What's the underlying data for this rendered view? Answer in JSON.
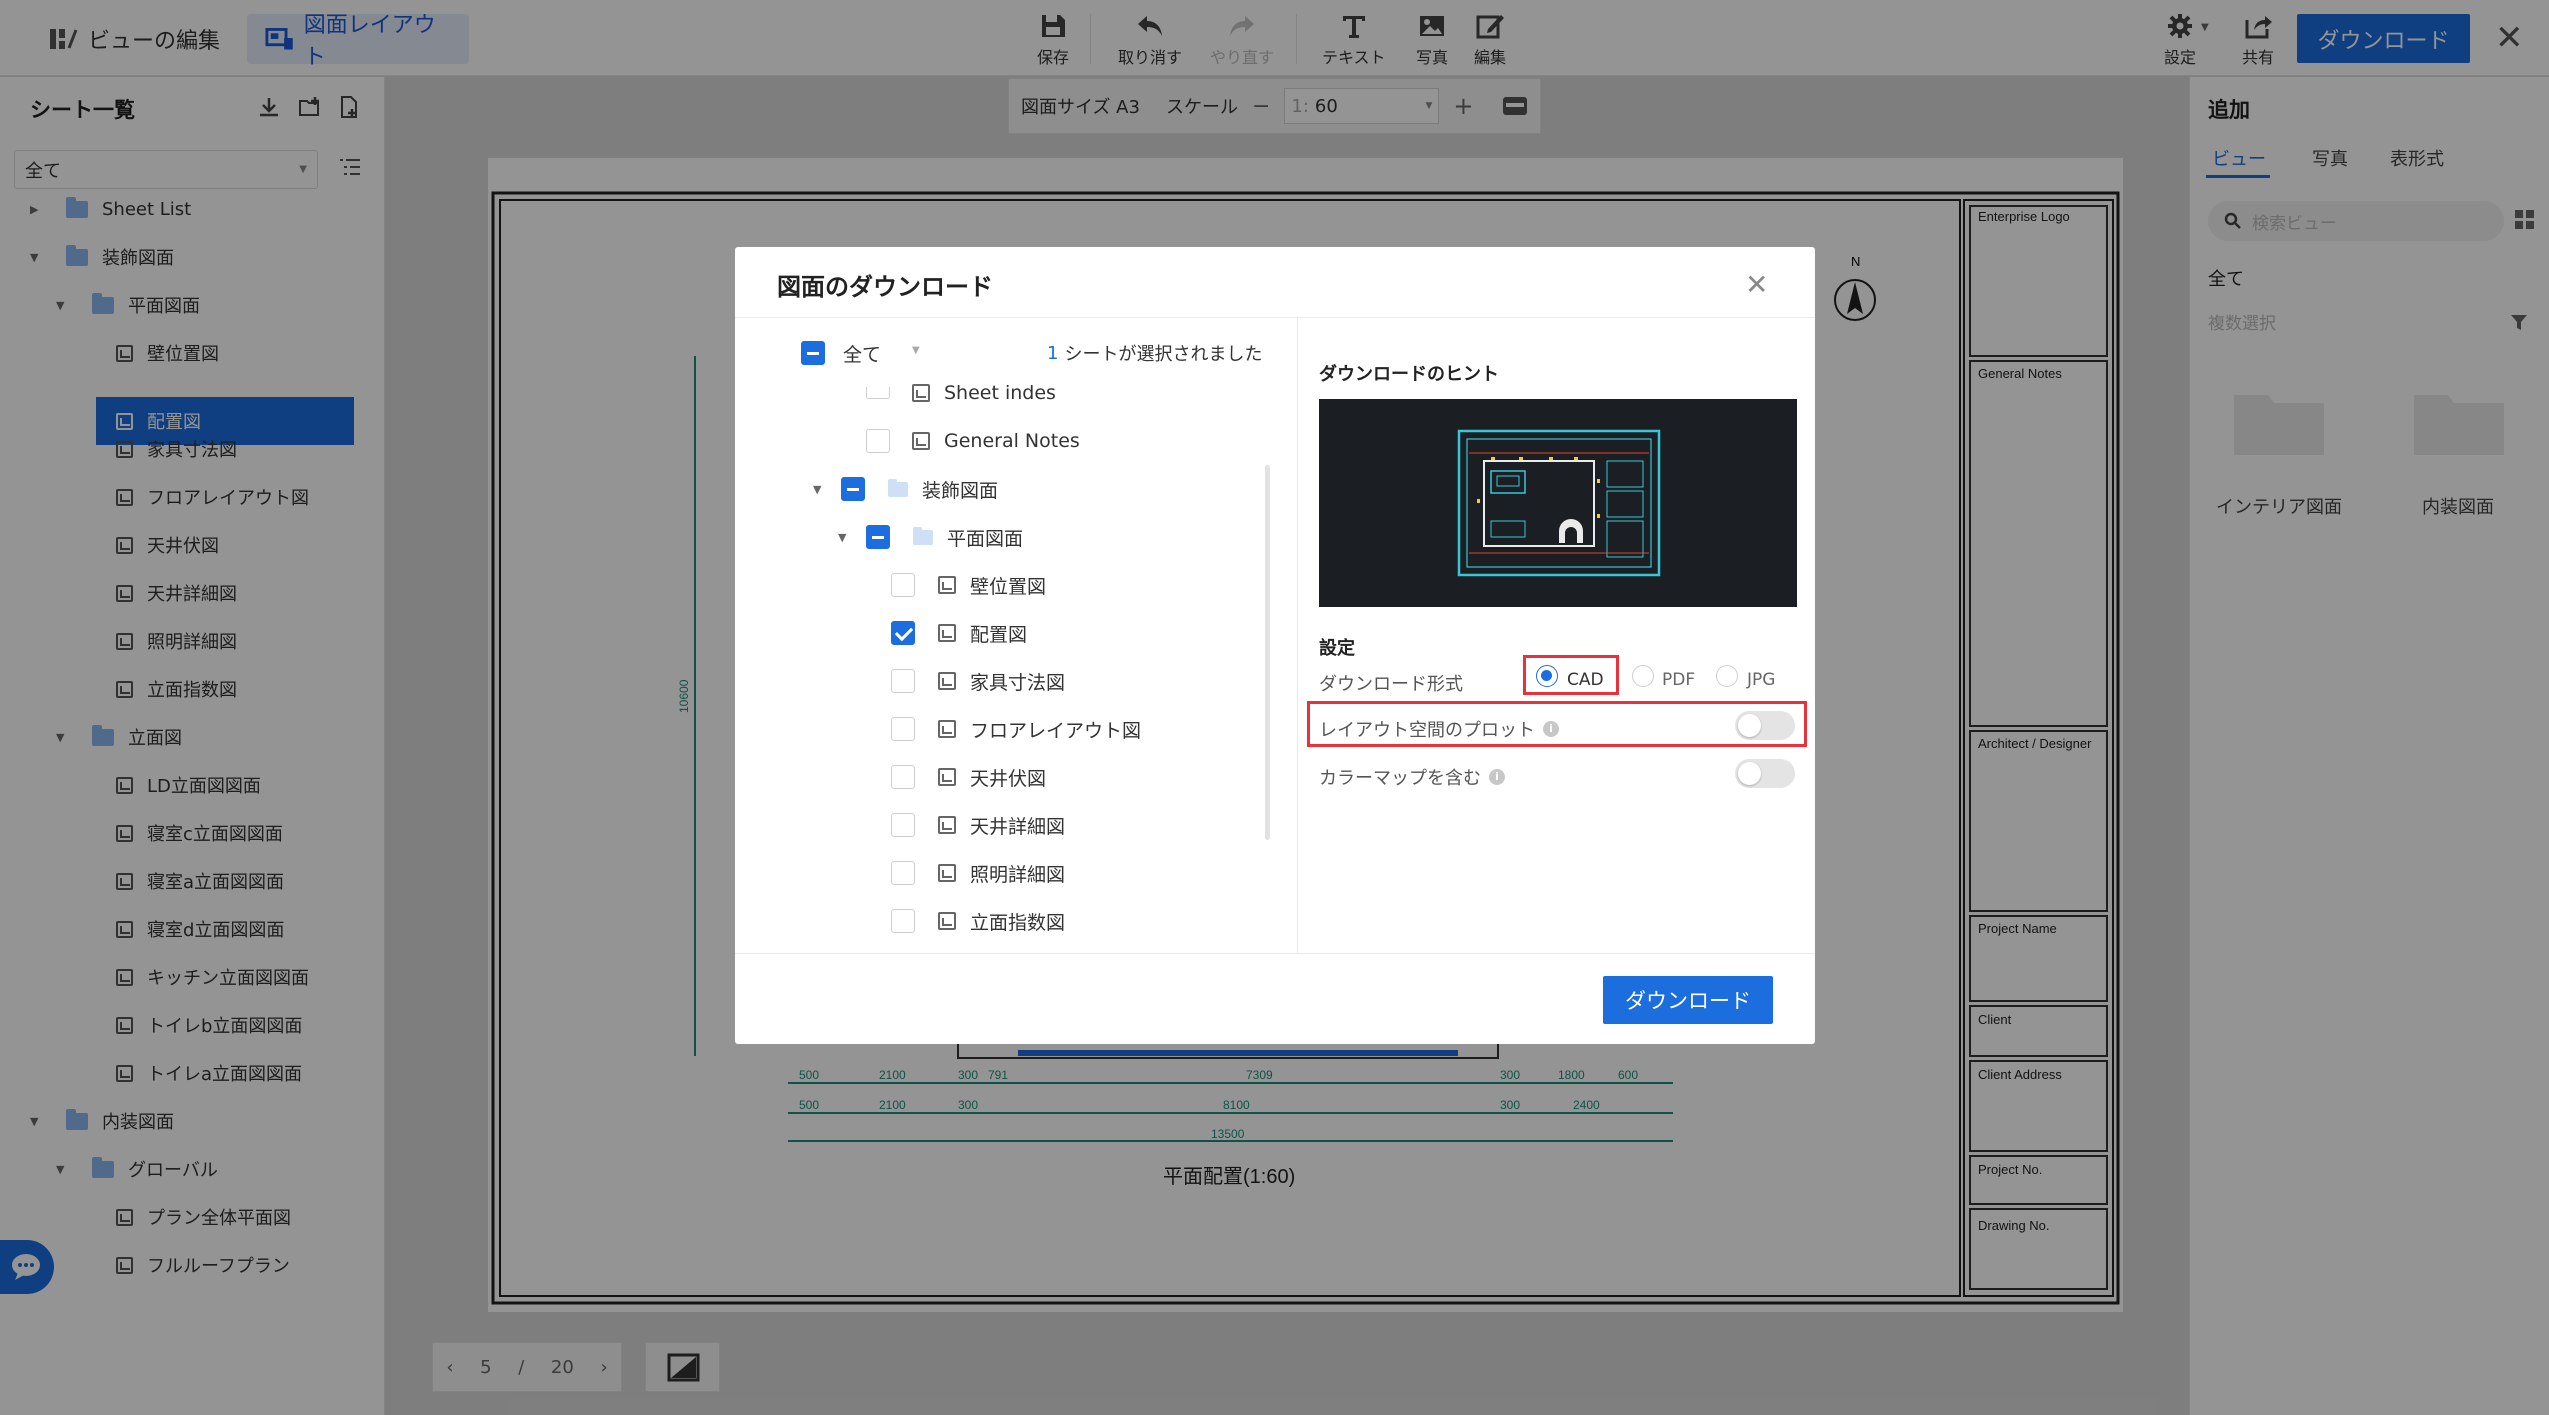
{
  "topbar": {
    "mode_view_edit": "ビューの編集",
    "mode_layout": "図面レイアウト",
    "tools": {
      "save": "保存",
      "undo": "取り消す",
      "redo": "やり直す",
      "text": "テキスト",
      "photo": "写真",
      "edit": "編集"
    },
    "settings": "設定",
    "share": "共有",
    "download": "ダウンロード"
  },
  "sidebar": {
    "title": "シート一覧",
    "filter": "全て",
    "items": [
      {
        "label": "Sheet List"
      },
      {
        "label": "装飾図面"
      },
      {
        "label": "平面図面"
      },
      {
        "label": "壁位置図"
      },
      {
        "label": "配置図"
      },
      {
        "label": "家具寸法図"
      },
      {
        "label": "フロアレイアウト図"
      },
      {
        "label": "天井伏図"
      },
      {
        "label": "天井詳細図"
      },
      {
        "label": "照明詳細図"
      },
      {
        "label": "立面指数図"
      },
      {
        "label": "立面図"
      },
      {
        "label": "LD立面図図面"
      },
      {
        "label": "寝室c立面図図面"
      },
      {
        "label": "寝室a立面図図面"
      },
      {
        "label": "寝室d立面図図面"
      },
      {
        "label": "キッチン立面図図面"
      },
      {
        "label": "トイレb立面図図面"
      },
      {
        "label": "トイレa立面図図面"
      },
      {
        "label": "内装図面"
      },
      {
        "label": "グローバル"
      },
      {
        "label": "プラン全体平面図"
      },
      {
        "label": "フルルーフプラン"
      }
    ]
  },
  "canvas": {
    "paper_size": "図面サイズ A3",
    "scale_label": "スケール",
    "scale_prefix": "1:",
    "scale_value": "60",
    "pager": {
      "current": "5",
      "sep": "/",
      "total": "20"
    },
    "drawing": {
      "north": "N",
      "caption": "平面配置(1:60)",
      "vert_dim": "10600",
      "dim_row1": [
        "500",
        "2100",
        "300",
        "791",
        "7309",
        "300",
        "1800",
        "600"
      ],
      "dim_row2": [
        "500",
        "2100",
        "300",
        "8100",
        "300",
        "2400"
      ],
      "dim_total": "13500",
      "title_block": [
        "Enterprise Logo",
        "General Notes",
        "Architect / Designer",
        "Project Name",
        "Client",
        "Client Address",
        "Project No.",
        "Drawing No."
      ]
    }
  },
  "right": {
    "title": "追加",
    "tabs": [
      "ビュー",
      "写真",
      "表形式"
    ],
    "search_placeholder": "検索ビュー",
    "all": "全て",
    "multi_select": "複数選択",
    "folders": [
      "インテリア図面",
      "内装図面"
    ]
  },
  "modal": {
    "title": "図面のダウンロード",
    "all_label": "全て",
    "selected_count": "1",
    "selected_text": "シートが選択されました",
    "tree": [
      {
        "label": "Sheet indes",
        "type": "doc",
        "state": "off"
      },
      {
        "label": "General Notes",
        "type": "doc",
        "state": "off"
      },
      {
        "label": "装飾図面",
        "type": "folder",
        "state": "part"
      },
      {
        "label": "平面図面",
        "type": "folder",
        "state": "part"
      },
      {
        "label": "壁位置図",
        "type": "doc",
        "state": "off"
      },
      {
        "label": "配置図",
        "type": "doc",
        "state": "on"
      },
      {
        "label": "家具寸法図",
        "type": "doc",
        "state": "off"
      },
      {
        "label": "フロアレイアウト図",
        "type": "doc",
        "state": "off"
      },
      {
        "label": "天井伏図",
        "type": "doc",
        "state": "off"
      },
      {
        "label": "天井詳細図",
        "type": "doc",
        "state": "off"
      },
      {
        "label": "照明詳細図",
        "type": "doc",
        "state": "off"
      },
      {
        "label": "立面指数図",
        "type": "doc",
        "state": "off"
      }
    ],
    "hint_title": "ダウンロードのヒント",
    "settings_title": "設定",
    "format_label": "ダウンロード形式",
    "formats": [
      "CAD",
      "PDF",
      "JPG"
    ],
    "selected_format": "CAD",
    "layout_plot_label": "レイアウト空間のプロット",
    "layout_plot_on": false,
    "colormap_label": "カラーマップを含む",
    "colormap_on": false,
    "download": "ダウンロード"
  },
  "colors": {
    "accent": "#1c6dde",
    "highlight": "#e8313b"
  }
}
